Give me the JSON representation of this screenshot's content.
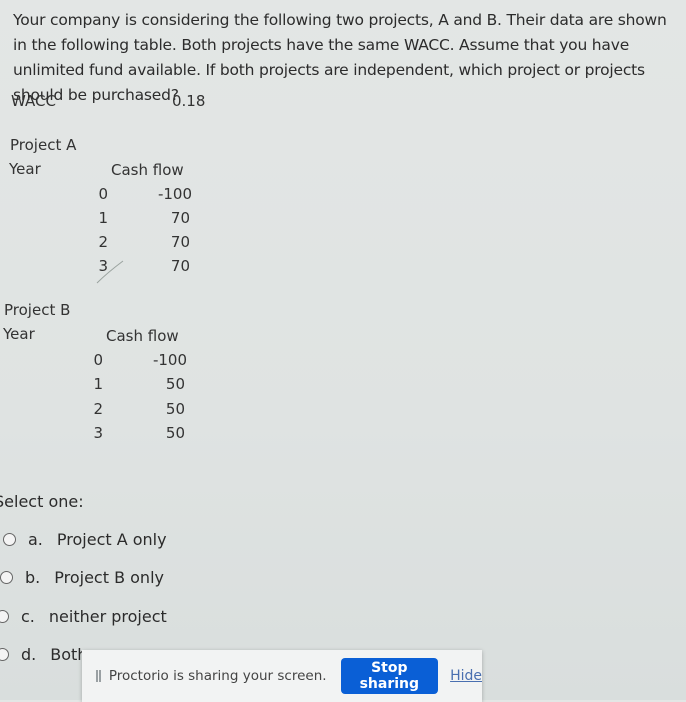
{
  "question": {
    "text": "Your company is considering the following two projects, A and B. Their data are shown in the following table. Both projects have the same WACC. Assume that you have unlimited fund available. If both projects are independent, which project or projects should be purchased?",
    "wacc_label": "WACC",
    "wacc_value": "0.18"
  },
  "project_a": {
    "title": "Project A",
    "year_header": "Year",
    "cf_header": "Cash flow",
    "rows": [
      {
        "year": "0",
        "cf": "-100"
      },
      {
        "year": "1",
        "cf": "70"
      },
      {
        "year": "2",
        "cf": "70"
      },
      {
        "year": "3",
        "cf": "70"
      }
    ]
  },
  "project_b": {
    "title": "Project B",
    "year_header": "Year",
    "cf_header": "Cash flow",
    "rows": [
      {
        "year": "0",
        "cf": "-100"
      },
      {
        "year": "1",
        "cf": "50"
      },
      {
        "year": "2",
        "cf": "50"
      },
      {
        "year": "3",
        "cf": "50"
      }
    ]
  },
  "answers": {
    "prompt": "Select one:",
    "options": [
      {
        "letter": "a.",
        "label": "Project A only"
      },
      {
        "letter": "b.",
        "label": "Project B only"
      },
      {
        "letter": "c.",
        "label": "neither project"
      },
      {
        "letter": "d.",
        "label": "Both"
      }
    ]
  },
  "banner": {
    "message": "Proctorio is sharing your screen.",
    "stop_label": "Stop sharing",
    "hide_label": "Hide",
    "button_color": "#0a5fd6"
  }
}
